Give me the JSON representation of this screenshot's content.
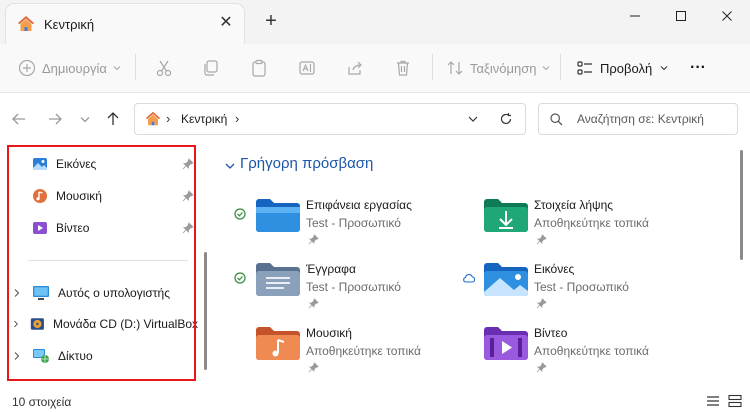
{
  "tab": {
    "title": "Κεντρική",
    "close": "✕",
    "new": "+"
  },
  "window": {
    "minimize": "—",
    "maximize": "☐",
    "close": "✕"
  },
  "toolbar": {
    "new_label": "Δημιουργία",
    "sort_label": "Ταξινόμηση",
    "view_label": "Προβολή",
    "more_label": "···"
  },
  "address": {
    "crumb": "Κεντρική",
    "chevron": "›"
  },
  "search": {
    "placeholder": "Αναζήτηση σε: Κεντρική"
  },
  "sidebar": {
    "pinned": [
      {
        "label": "Εικόνες",
        "icon": "pictures-icon"
      },
      {
        "label": "Μουσική",
        "icon": "music-icon"
      },
      {
        "label": "Βίντεο",
        "icon": "video-icon"
      }
    ],
    "devices": [
      {
        "label": "Αυτός ο υπολογιστής",
        "icon": "computer-icon"
      },
      {
        "label": "Μονάδα CD (D:) VirtualBox",
        "icon": "cd-drive-icon"
      },
      {
        "label": "Δίκτυο",
        "icon": "network-icon"
      }
    ],
    "highlight_color": "#e8161b"
  },
  "quick_access": {
    "title": "Γρήγορη πρόσβαση",
    "items": [
      {
        "name": "Επιφάνεια εργασίας",
        "sub": "Test - Προσωπικό",
        "status": "synced",
        "folder": "desktop",
        "color": "#2a7fd4"
      },
      {
        "name": "Στοιχεία λήψης",
        "sub": "Αποθηκεύτηκε τοπικά",
        "status": "",
        "folder": "downloads",
        "color": "#1a9b6f"
      },
      {
        "name": "Έγγραφα",
        "sub": "Test - Προσωπικό",
        "status": "synced",
        "folder": "documents",
        "color": "#7a8ea6"
      },
      {
        "name": "Εικόνες",
        "sub": "Test - Προσωπικό",
        "status": "cloud",
        "folder": "pictures",
        "color": "#2a7fd4"
      },
      {
        "name": "Μουσική",
        "sub": "Αποθηκεύτηκε τοπικά",
        "status": "",
        "folder": "music",
        "color": "#e0703c"
      },
      {
        "name": "Βίντεο",
        "sub": "Αποθηκεύτηκε τοπικά",
        "status": "",
        "folder": "videos",
        "color": "#8a4fd1"
      }
    ]
  },
  "status": {
    "count": "10 στοιχεία"
  }
}
